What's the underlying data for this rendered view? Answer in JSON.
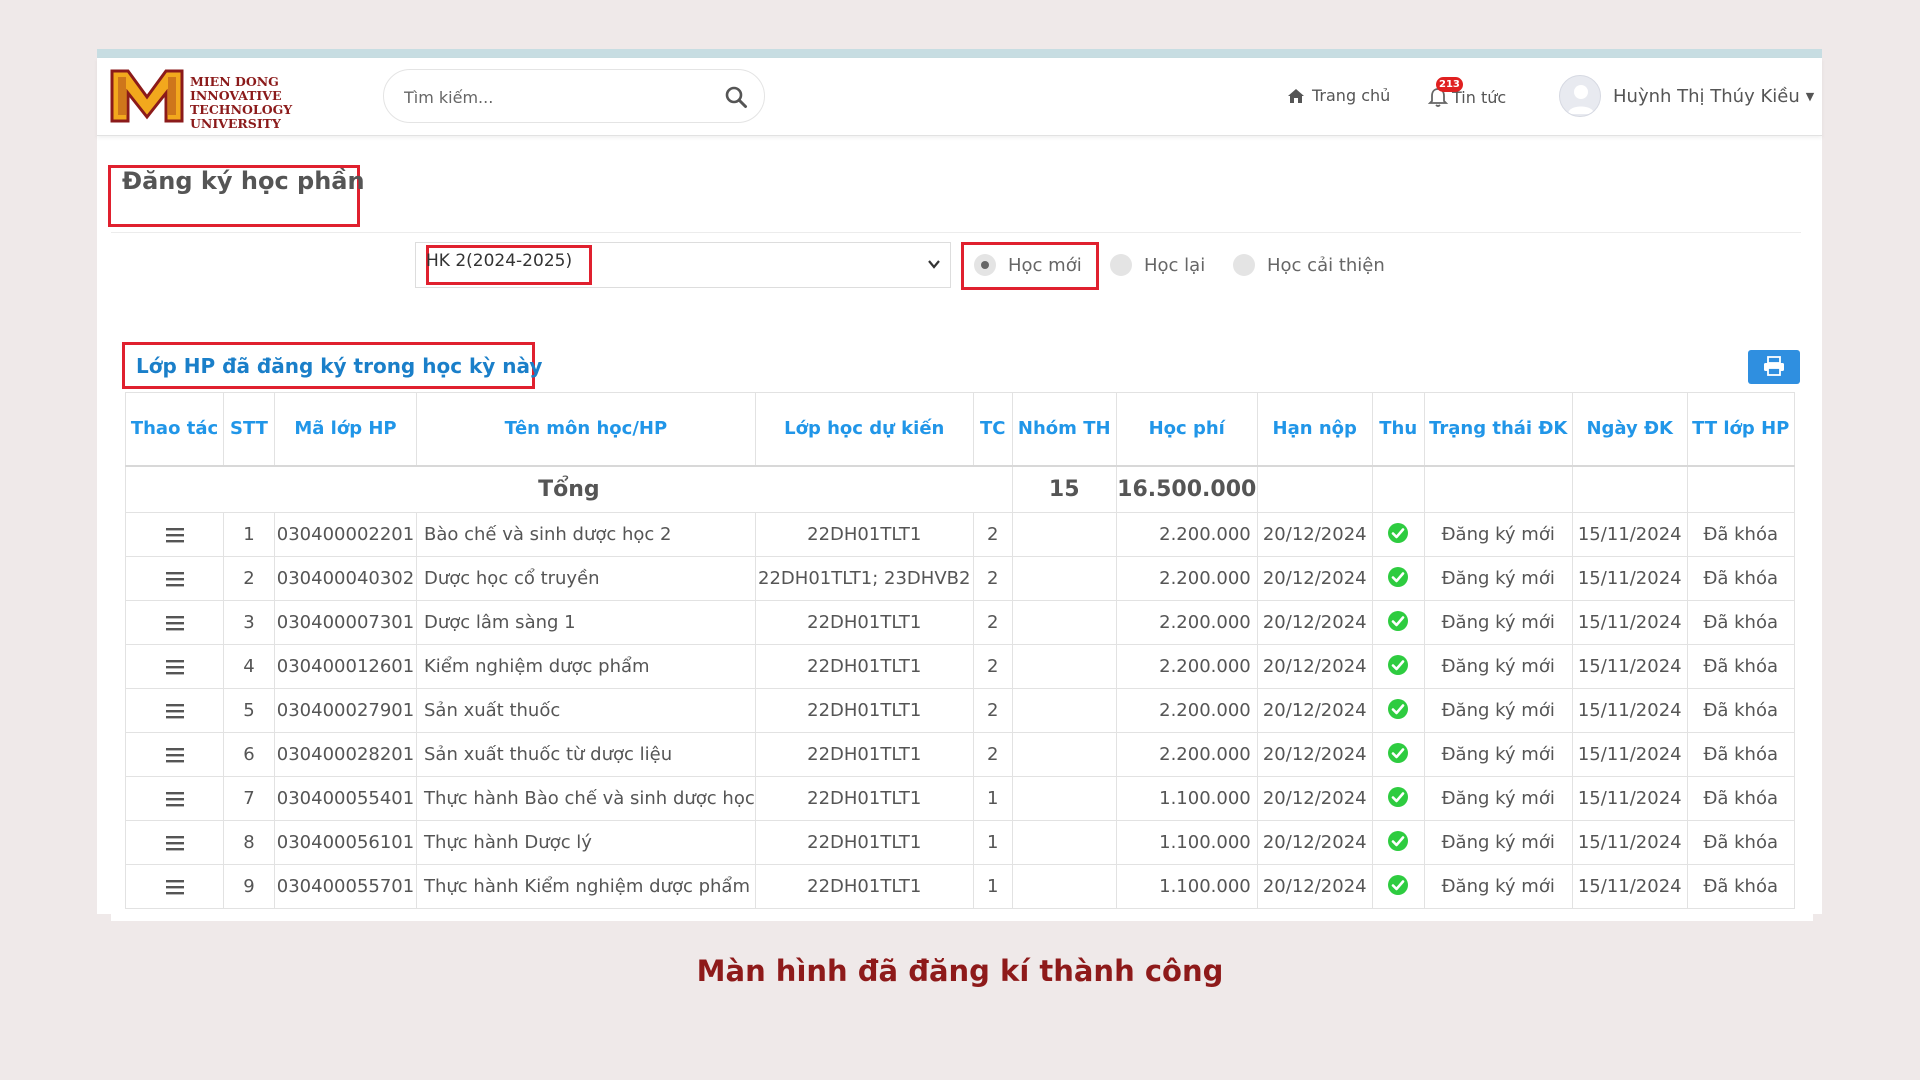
{
  "header": {
    "logo_lines": [
      "MIEN DONG",
      "INNOVATIVE TECHNOLOGY",
      "UNIVERSITY"
    ],
    "logo_letter": "M",
    "search_placeholder": "Tìm kiếm...",
    "home_label": "Trang chủ",
    "news_label": "Tin tức",
    "news_badge": "213",
    "user_name": "Huỳnh Thị Thúy Kiều"
  },
  "page": {
    "title": "Đăng ký học phần",
    "semester_selected": "HK 2(2024-2025)",
    "radios": [
      {
        "label": "Học mới",
        "checked": true
      },
      {
        "label": "Học lại",
        "checked": false
      },
      {
        "label": "Học cải thiện",
        "checked": false
      }
    ],
    "section_title": "Lớp HP đã đăng ký trong học kỳ này"
  },
  "table": {
    "columns": [
      "Thao tác",
      "STT",
      "Mã lớp HP",
      "Tên môn học/HP",
      "Lớp học dự kiến",
      "TC",
      "Nhóm TH",
      "Học phí",
      "Hạn nộp",
      "Thu",
      "Trạng thái ĐK",
      "Ngày ĐK",
      "TT lớp HP"
    ],
    "total": {
      "label": "Tổng",
      "credits": "15",
      "fee": "16.500.000"
    },
    "rows": [
      {
        "stt": "1",
        "code": "030400002201",
        "name": "Bào chế và sinh dược học 2",
        "class": "22DH01TLT1",
        "tc": "2",
        "group": "",
        "fee": "2.200.000",
        "due": "20/12/2024",
        "status": "Đăng ký mới",
        "date": "15/11/2024",
        "class_status": "Đã khóa"
      },
      {
        "stt": "2",
        "code": "030400040302",
        "name": "Dược học cổ truyền",
        "class": "22DH01TLT1; 23DHVB2",
        "tc": "2",
        "group": "",
        "fee": "2.200.000",
        "due": "20/12/2024",
        "status": "Đăng ký mới",
        "date": "15/11/2024",
        "class_status": "Đã khóa"
      },
      {
        "stt": "3",
        "code": "030400007301",
        "name": "Dược lâm sàng 1",
        "class": "22DH01TLT1",
        "tc": "2",
        "group": "",
        "fee": "2.200.000",
        "due": "20/12/2024",
        "status": "Đăng ký mới",
        "date": "15/11/2024",
        "class_status": "Đã khóa"
      },
      {
        "stt": "4",
        "code": "030400012601",
        "name": "Kiểm nghiệm dược phẩm",
        "class": "22DH01TLT1",
        "tc": "2",
        "group": "",
        "fee": "2.200.000",
        "due": "20/12/2024",
        "status": "Đăng ký mới",
        "date": "15/11/2024",
        "class_status": "Đã khóa"
      },
      {
        "stt": "5",
        "code": "030400027901",
        "name": "Sản xuất thuốc",
        "class": "22DH01TLT1",
        "tc": "2",
        "group": "",
        "fee": "2.200.000",
        "due": "20/12/2024",
        "status": "Đăng ký mới",
        "date": "15/11/2024",
        "class_status": "Đã khóa"
      },
      {
        "stt": "6",
        "code": "030400028201",
        "name": "Sản xuất thuốc từ dược liệu",
        "class": "22DH01TLT1",
        "tc": "2",
        "group": "",
        "fee": "2.200.000",
        "due": "20/12/2024",
        "status": "Đăng ký mới",
        "date": "15/11/2024",
        "class_status": "Đã khóa"
      },
      {
        "stt": "7",
        "code": "030400055401",
        "name": "Thực hành Bào chế và sinh dược học",
        "class": "22DH01TLT1",
        "tc": "1",
        "group": "",
        "fee": "1.100.000",
        "due": "20/12/2024",
        "status": "Đăng ký mới",
        "date": "15/11/2024",
        "class_status": "Đã khóa"
      },
      {
        "stt": "8",
        "code": "030400056101",
        "name": "Thực hành Dược lý",
        "class": "22DH01TLT1",
        "tc": "1",
        "group": "",
        "fee": "1.100.000",
        "due": "20/12/2024",
        "status": "Đăng ký mới",
        "date": "15/11/2024",
        "class_status": "Đã khóa"
      },
      {
        "stt": "9",
        "code": "030400055701",
        "name": "Thực hành Kiểm nghiệm dược phẩm",
        "class": "22DH01TLT1",
        "tc": "1",
        "group": "",
        "fee": "1.100.000",
        "due": "20/12/2024",
        "status": "Đăng ký mới",
        "date": "15/11/2024",
        "class_status": "Đã khóa"
      }
    ]
  },
  "caption": "Màn hình đã đăng kí thành công",
  "colors": {
    "accent_blue": "#2196e8",
    "highlight_red": "#e0202e",
    "paid_green": "#2ecc40",
    "caption_red": "#8e1a1a"
  },
  "icons": [
    "search-icon",
    "home-icon",
    "bell-icon",
    "user-avatar-icon",
    "chevron-down-icon",
    "print-icon",
    "menu-icon",
    "check-circle-icon"
  ]
}
